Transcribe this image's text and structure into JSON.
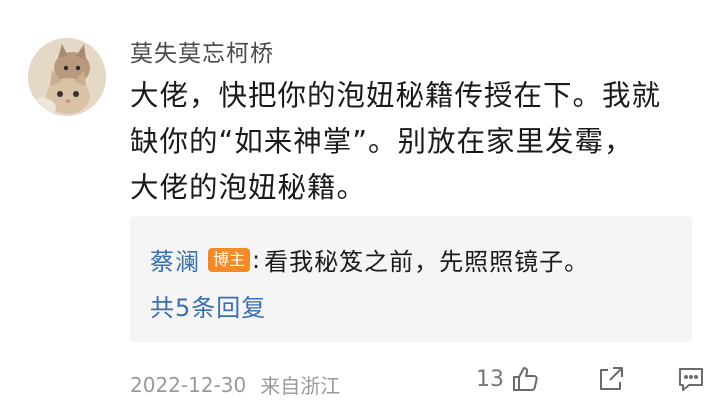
{
  "comment": {
    "username": "莫失莫忘柯桥",
    "text_lines": [
      "大佬，快把你的泡妞秘籍传授在下。我就",
      "缺你的“如来神掌”。别放在家里发霉，",
      "大佬的泡妞秘籍。"
    ],
    "date": "2022-12-30",
    "location": "来自浙江",
    "likes": "13"
  },
  "reply": {
    "username": "蔡澜",
    "badge": "博主",
    "colon": ":",
    "text": "看我秘笈之前，先照照镜子。",
    "more_replies": "共5条回复"
  },
  "icons": {
    "avatar": "cat-photo-avatar",
    "like": "thumbs-up-icon",
    "share": "share-icon",
    "comment": "comment-icon"
  },
  "colors": {
    "link_blue": "#3a6fb0",
    "badge_orange": "#f28a29",
    "reply_bg": "#f5f5f5",
    "meta_gray": "#9a9a9a"
  }
}
